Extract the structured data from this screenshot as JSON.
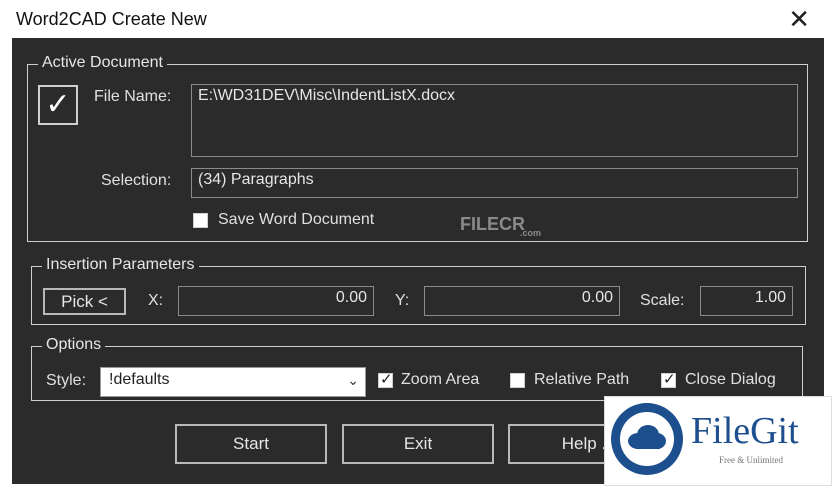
{
  "window": {
    "title": "Word2CAD Create New",
    "close_symbol": "✕"
  },
  "active_document": {
    "legend": "Active Document",
    "enabled_check_symbol": "✓",
    "file_name_label": "File Name:",
    "file_name_value": "E:\\WD31DEV\\Misc\\IndentListX.docx",
    "selection_label": "Selection:",
    "selection_value": "(34) Paragraphs",
    "save_word_label": "Save Word Document",
    "save_word_checked": false
  },
  "insertion": {
    "legend": "Insertion Parameters",
    "pick_label": "Pick <",
    "x_label": "X:",
    "x_value": "0.00",
    "y_label": "Y:",
    "y_value": "0.00",
    "scale_label": "Scale:",
    "scale_value": "1.00"
  },
  "options": {
    "legend": "Options",
    "style_label": "Style:",
    "style_value": "!defaults",
    "zoom_area_label": "Zoom Area",
    "zoom_area_checked": true,
    "relative_path_label": "Relative Path",
    "relative_path_checked": false,
    "close_dialog_label": "Close Dialog",
    "close_dialog_checked": true
  },
  "buttons": {
    "start": "Start",
    "exit": "Exit",
    "help": "Help ."
  },
  "watermark": {
    "text": "FILECR",
    "sub": ".com"
  },
  "logo": {
    "name": "FileGit",
    "tagline": "Free & Unlimited",
    "brand_color": "#1d4f8f"
  }
}
